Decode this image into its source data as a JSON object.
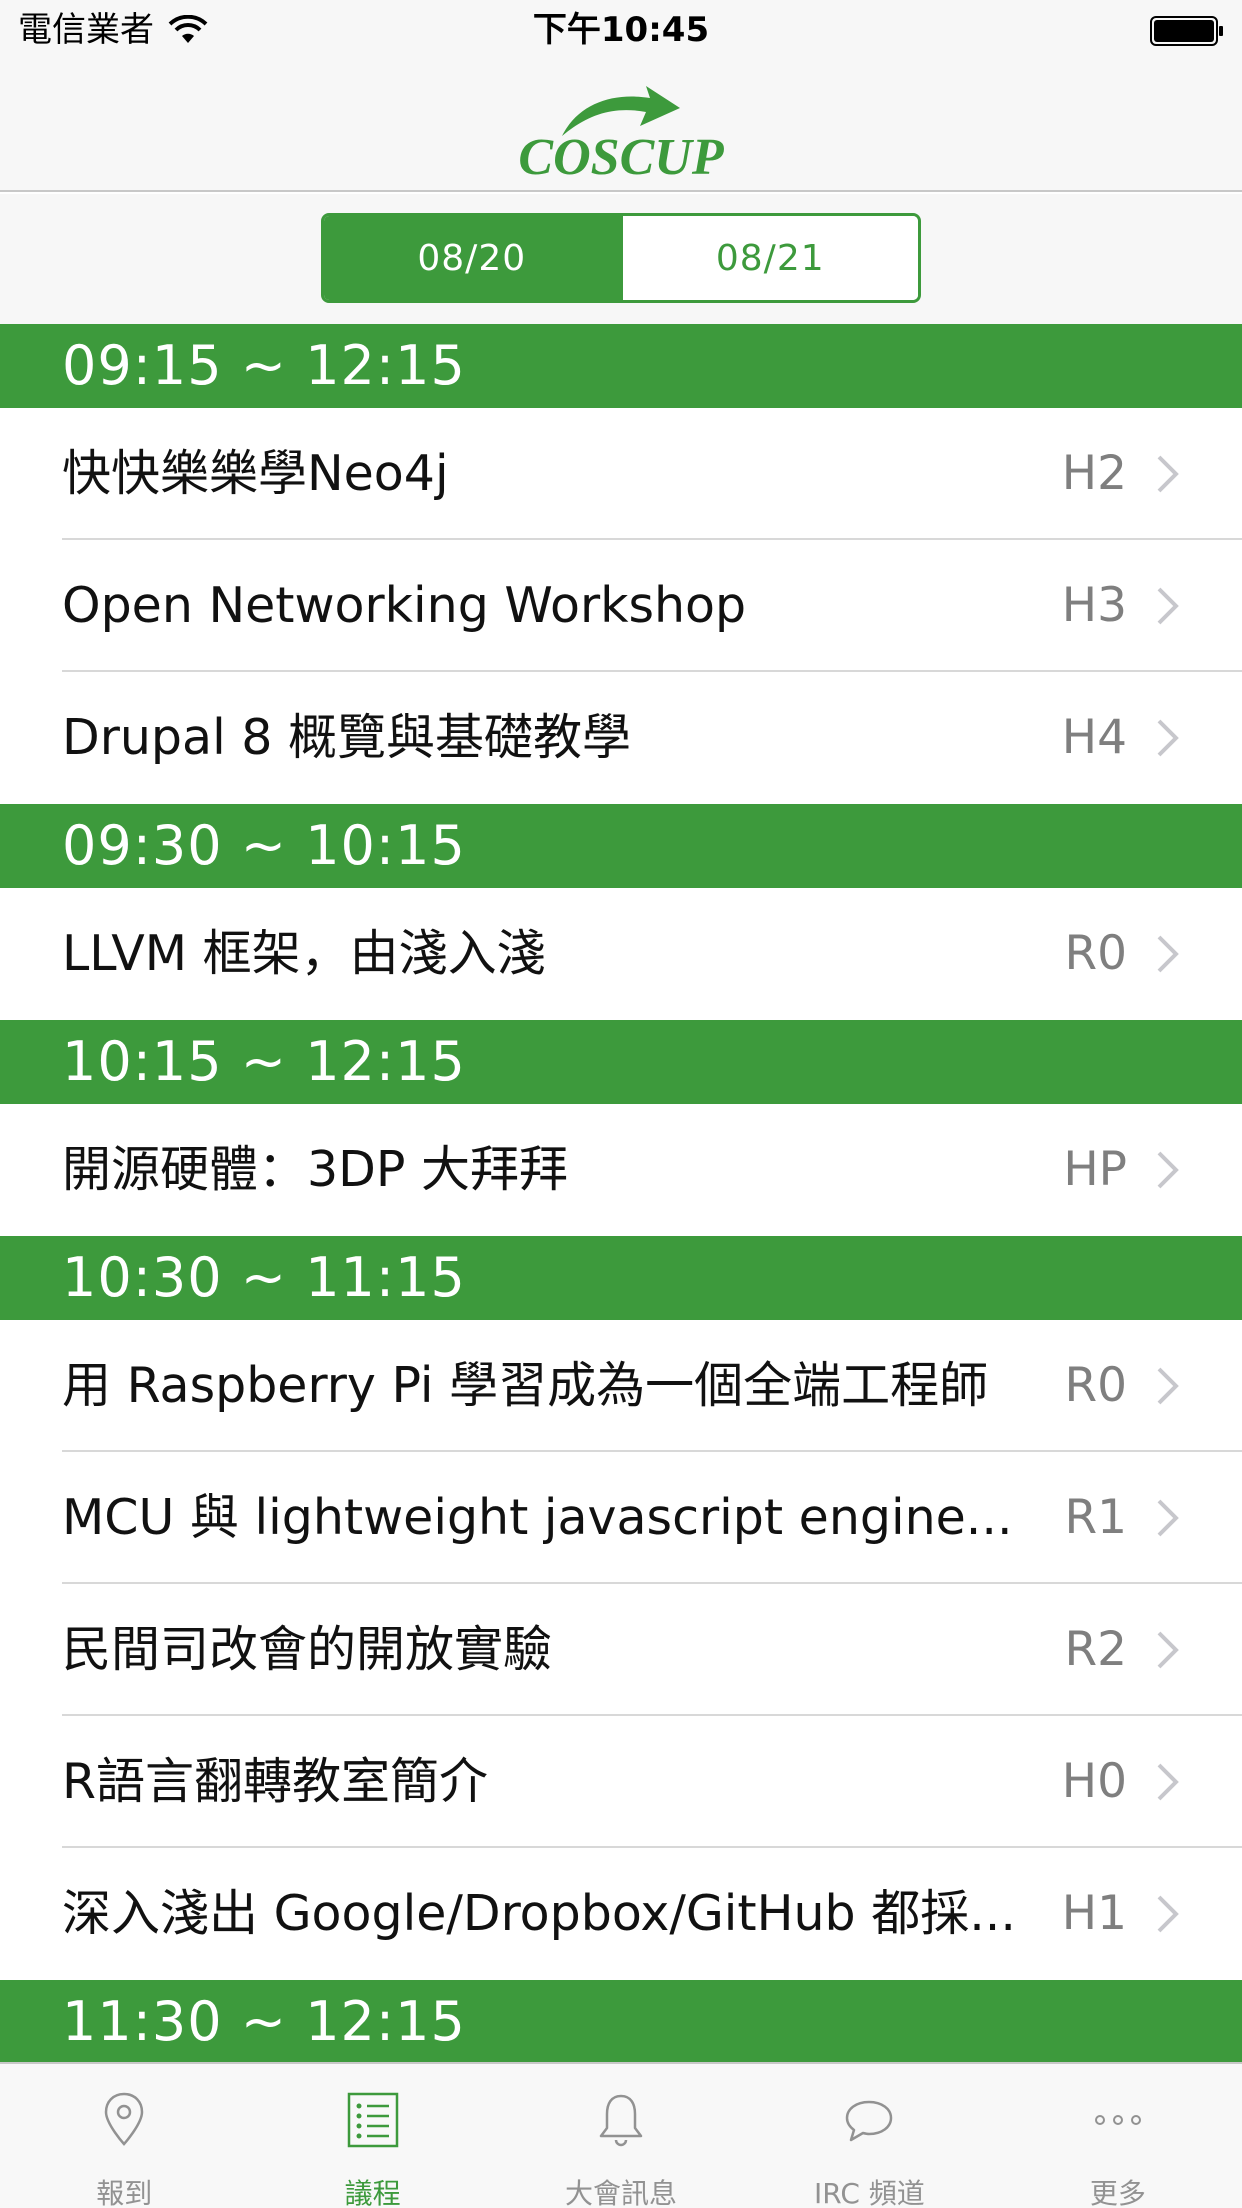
{
  "status_bar": {
    "carrier": "電信業者",
    "time": "下午10:45"
  },
  "nav": {
    "logo_text": "COSCUP"
  },
  "segments": {
    "day1": "08/20",
    "day2": "08/21",
    "selected": "08/20"
  },
  "sections": [
    {
      "time": "09:15 ~ 12:15",
      "sessions": [
        {
          "title": "快快樂樂學Neo4j",
          "room": "H2"
        },
        {
          "title": "Open Networking Workshop",
          "room": "H3"
        },
        {
          "title": "Drupal 8 概覽與基礎教學",
          "room": "H4"
        }
      ]
    },
    {
      "time": "09:30 ~ 10:15",
      "sessions": [
        {
          "title": "LLVM 框架，由淺入淺",
          "room": "R0"
        }
      ]
    },
    {
      "time": "10:15 ~ 12:15",
      "sessions": [
        {
          "title": "開源硬體：3DP 大拜拜",
          "room": "HP"
        }
      ]
    },
    {
      "time": "10:30 ~ 11:15",
      "sessions": [
        {
          "title": "用 Raspberry Pi 學習成為一個全端工程師",
          "room": "R0"
        },
        {
          "title": "MCU 與 lightweight javascript engine...",
          "room": "R1"
        },
        {
          "title": "民間司改會的開放實驗",
          "room": "R2"
        },
        {
          "title": "R語言翻轉教室簡介",
          "room": "H0"
        },
        {
          "title": "深入淺出 Google/Dropbox/GitHub 都採...",
          "room": "H1"
        }
      ]
    },
    {
      "time": "11:30 ~ 12:15",
      "sessions": []
    }
  ],
  "tabs": [
    {
      "label": "報到",
      "icon": "location-pin-icon"
    },
    {
      "label": "議程",
      "icon": "schedule-list-icon",
      "active": true
    },
    {
      "label": "大會訊息",
      "icon": "bell-icon"
    },
    {
      "label": "IRC 頻道",
      "icon": "chat-bubble-icon"
    },
    {
      "label": "更多",
      "icon": "more-dots-icon"
    }
  ],
  "colors": {
    "accent": "#3d9a3c",
    "room_text": "#7f7f7f",
    "tab_inactive": "#929292"
  }
}
